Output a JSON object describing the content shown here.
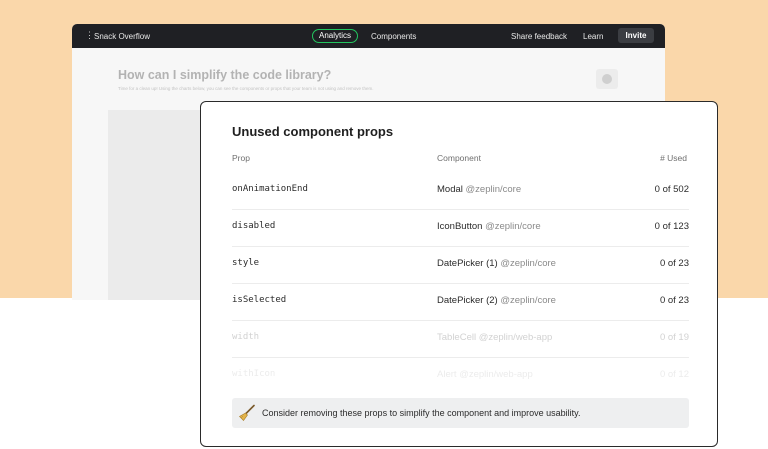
{
  "topbar": {
    "menu_icon": "kebab-menu-icon",
    "app_name": "Snack Overflow",
    "tabs": [
      {
        "label": "Analytics",
        "active": true
      },
      {
        "label": "Components",
        "active": false
      }
    ],
    "share_feedback": "Share feedback",
    "learn": "Learn",
    "invite": "Invite",
    "accent_color": "#22c55e"
  },
  "background_page": {
    "heading": "How can I simplify the code library?",
    "subtext": "Time for a clean up! Using the charts below, you can see the components or props that your team is not using and remove them."
  },
  "card": {
    "title": "Unused component props",
    "columns": {
      "prop": "Prop",
      "component": "Component",
      "used": "# Used"
    },
    "rows": [
      {
        "prop": "onAnimationEnd",
        "component": "Modal",
        "package": "@zeplin/core",
        "used": "0 of 502"
      },
      {
        "prop": "disabled",
        "component": "IconButton",
        "package": "@zeplin/core",
        "used": "0 of 123"
      },
      {
        "prop": "style",
        "component": "DatePicker (1)",
        "package": "@zeplin/core",
        "used": "0 of 23"
      },
      {
        "prop": "isSelected",
        "component": "DatePicker (2)",
        "package": "@zeplin/core",
        "used": "0 of 23"
      },
      {
        "prop": "width",
        "component": "TableCell",
        "package": "@zeplin/web-app",
        "used": "0 of 19"
      },
      {
        "prop": "withIcon",
        "component": "Alert",
        "package": "@zeplin/web-app",
        "used": "0 of 12"
      }
    ],
    "tip_icon": "broom-icon",
    "tip": "Consider removing these props to simplify the component and improve usability."
  }
}
